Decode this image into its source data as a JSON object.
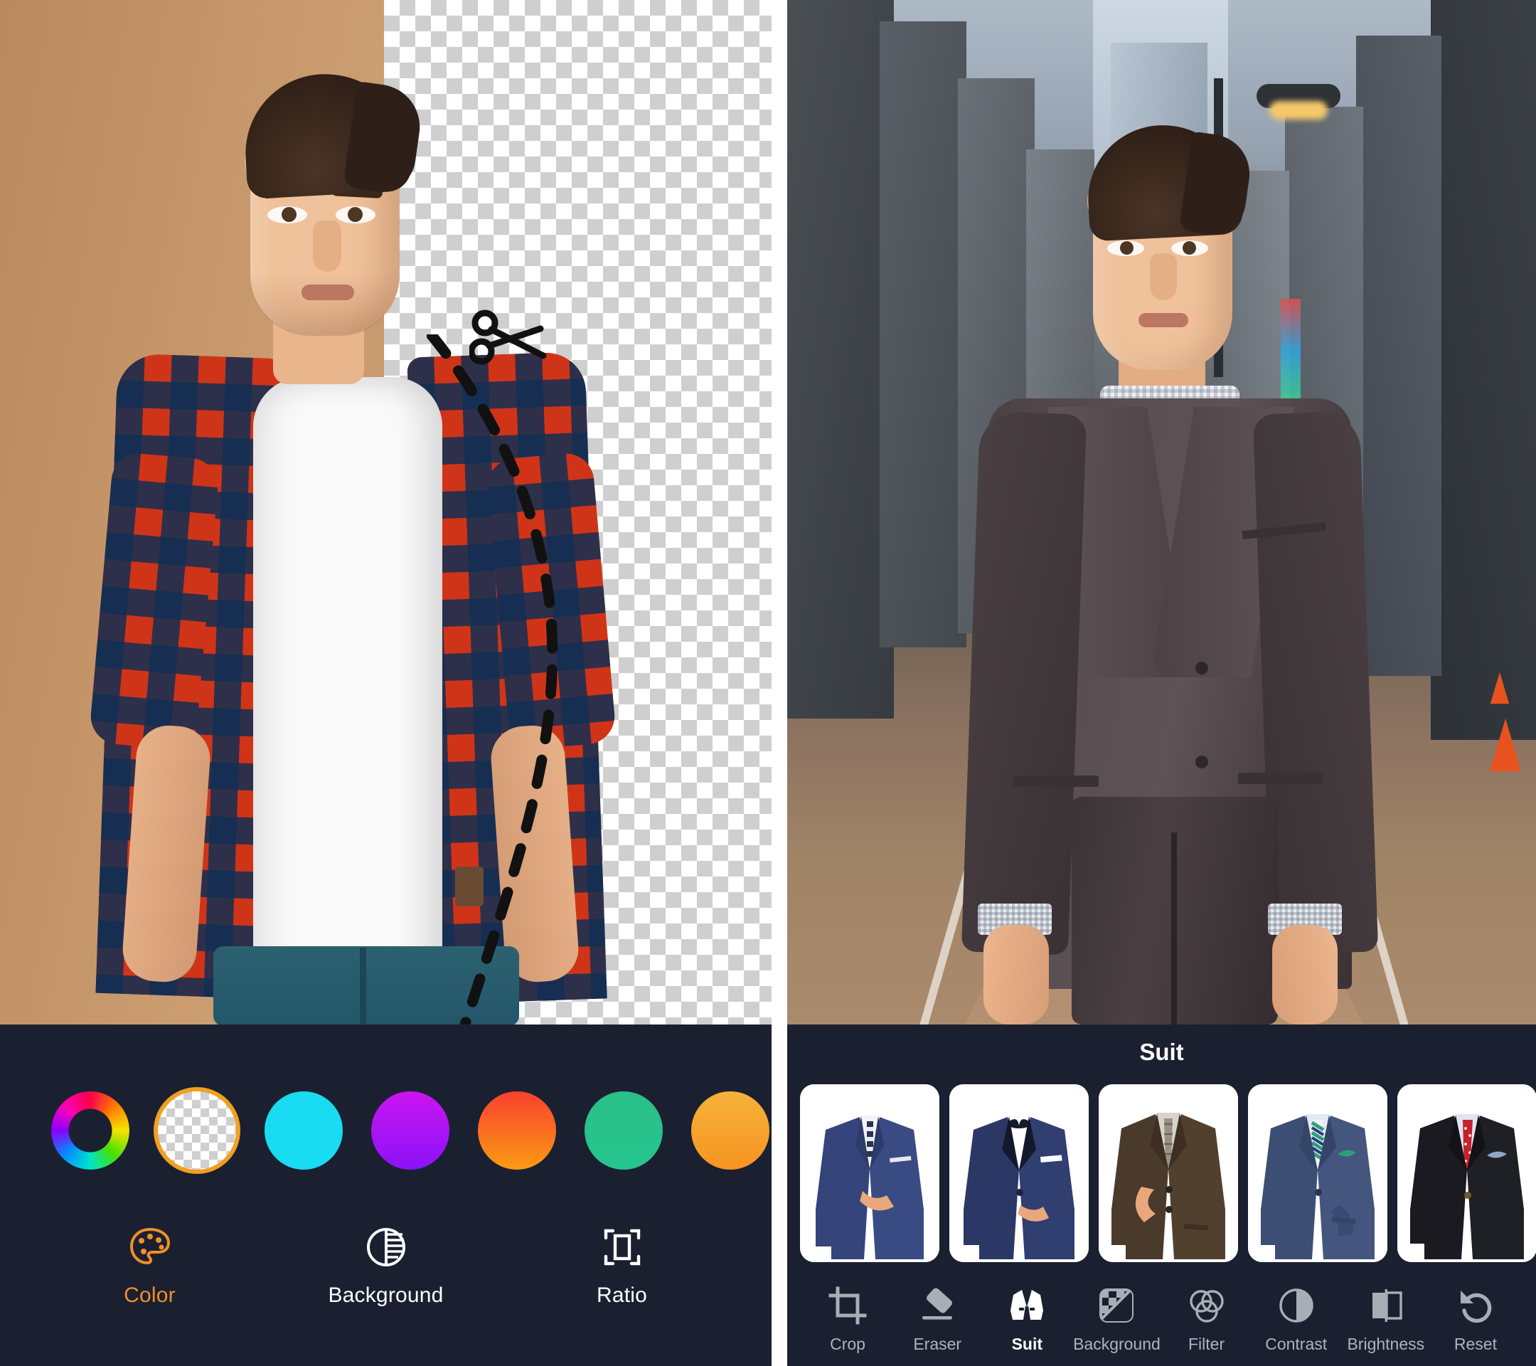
{
  "left_editor": {
    "stage": {
      "photo_alt": "man in red and navy plaid shirt over white tee and jeans",
      "background_left_label": "tan studio backdrop",
      "background_right_label": "transparent checkerboard",
      "cutout_icon": "scissors-icon",
      "cut_path_style": "dashed"
    },
    "colors": {
      "accent_hex": "#f0902a",
      "bar_hex": "#1b2030",
      "selected_index": 1
    },
    "swatches": [
      {
        "name": "color-wheel-swatch",
        "label": "Color wheel",
        "kind": "wheel",
        "hex": ""
      },
      {
        "name": "transparent-swatch",
        "label": "Transparent",
        "kind": "transparent",
        "hex": ""
      },
      {
        "name": "cyan-swatch",
        "label": "Cyan",
        "kind": "solid",
        "hex": "#19dcf2"
      },
      {
        "name": "purple-swatch",
        "label": "Purple",
        "kind": "gradient",
        "hex": "#cb14f0"
      },
      {
        "name": "orange-swatch",
        "label": "Orange",
        "kind": "gradient",
        "hex": "#f9402f"
      },
      {
        "name": "green-swatch",
        "label": "Green",
        "kind": "gradient",
        "hex": "#2bbf89"
      },
      {
        "name": "amber-swatch",
        "label": "Amber",
        "kind": "gradient",
        "hex": "#f5b23a"
      }
    ],
    "tools": [
      {
        "label": "Color",
        "icon": "palette-icon",
        "active": true
      },
      {
        "label": "Background",
        "icon": "background-split-icon",
        "active": false
      },
      {
        "label": "Ratio",
        "icon": "ratio-frame-icon",
        "active": false
      }
    ]
  },
  "right_editor": {
    "stage": {
      "photo_alt": "man in dark grey suit with dotted navy tie standing on a city street",
      "background_label": "blurred city street"
    },
    "title": "Suit",
    "suit_thumbnails": [
      {
        "name": "suit-thumb-navy-check-tie",
        "label": "Navy suit with checkered tie",
        "body": "#35447a",
        "lapel": "#2d3b6b",
        "shirt": "#f2f4f8",
        "tie": "#e9edf3",
        "accessory": "pocket-square"
      },
      {
        "name": "suit-thumb-navy-tuxedo",
        "label": "Navy tuxedo with bow tie",
        "body": "#2b3866",
        "lapel": "#13192c",
        "shirt": "#ffffff",
        "tie": "#151b2e",
        "accessory": "bow-tie"
      },
      {
        "name": "suit-thumb-brown-plaid-tie",
        "label": "Brown suit with plaid tie",
        "body": "#4a3a2b",
        "lapel": "#3d2f22",
        "shirt": "#d8d4cb",
        "tie": "#9a9184",
        "accessory": "none"
      },
      {
        "name": "suit-thumb-blue-striped-tie",
        "label": "Blue suit with striped tie",
        "body": "#3d4e74",
        "lapel": "#35456a",
        "shirt": "#e4e9f0",
        "tie": "#2f9e77",
        "accessory": "green-pocket-square"
      },
      {
        "name": "suit-thumb-black-red-tie",
        "label": "Black suit with red tie",
        "body": "#1a1a20",
        "lapel": "#121217",
        "shirt": "#dfe5ee",
        "tie": "#c4222c",
        "accessory": "blue-pocket-square"
      }
    ],
    "tools": [
      {
        "label": "Crop",
        "icon": "crop-icon",
        "active": false
      },
      {
        "label": "Eraser",
        "icon": "eraser-icon",
        "active": false
      },
      {
        "label": "Suit",
        "icon": "suit-jacket-icon",
        "active": true
      },
      {
        "label": "Background",
        "icon": "checkerboard-icon",
        "active": false
      },
      {
        "label": "Filter",
        "icon": "three-circles-filter-icon",
        "active": false
      },
      {
        "label": "Contrast",
        "icon": "contrast-half-circle-icon",
        "active": false
      },
      {
        "label": "Brightness",
        "icon": "brightness-split-square-icon",
        "active": false
      },
      {
        "label": "Reset",
        "icon": "undo-arrow-icon",
        "active": false
      }
    ]
  }
}
